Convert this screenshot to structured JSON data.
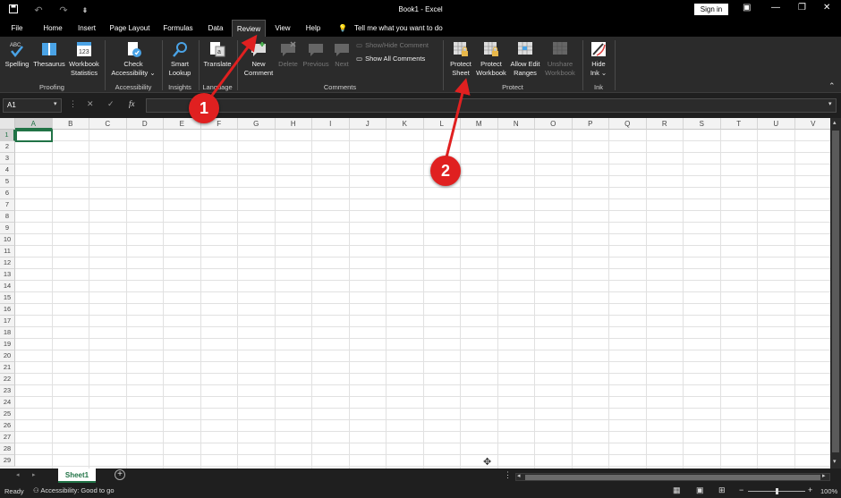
{
  "titlebar": {
    "doc_title": "Book1 - Excel",
    "signin_label": "Sign in",
    "icons": [
      "save-icon",
      "undo-icon",
      "redo-icon",
      "customize-icon"
    ]
  },
  "menu": {
    "tabs": [
      "File",
      "Home",
      "Insert",
      "Page Layout",
      "Formulas",
      "Data",
      "Review",
      "View",
      "Help"
    ],
    "active_tab": "Review",
    "tell_me": "Tell me what you want to do"
  },
  "ribbon": {
    "proofing": {
      "spelling": "Spelling",
      "spelling_abc": "ABC",
      "thesaurus": "Thesaurus",
      "workbook_stats_1": "Workbook",
      "workbook_stats_2": "Statistics",
      "label": "Proofing"
    },
    "accessibility": {
      "check_1": "Check",
      "check_2": "Accessibility ⌄",
      "label": "Accessibility"
    },
    "insights": {
      "smart_1": "Smart",
      "smart_2": "Lookup",
      "label": "Insights"
    },
    "language": {
      "translate": "Translate",
      "label": "Language"
    },
    "comments": {
      "new_1": "New",
      "new_2": "Comment",
      "delete": "Delete",
      "previous": "Previous",
      "next": "Next",
      "show_hide": "Show/Hide Comment",
      "show_all": "Show All Comments",
      "label": "Comments"
    },
    "protect": {
      "protect_sheet_1": "Protect",
      "protect_sheet_2": "Sheet",
      "protect_wb_1": "Protect",
      "protect_wb_2": "Workbook",
      "allow_edit_1": "Allow Edit",
      "allow_edit_2": "Ranges",
      "unshare_1": "Unshare",
      "unshare_2": "Workbook",
      "label": "Protect"
    },
    "ink": {
      "hide_1": "Hide",
      "hide_2": "Ink ⌄",
      "label": "Ink"
    }
  },
  "formula_bar": {
    "name_box": "A1",
    "cancel": "✕",
    "enter": "✓",
    "fx": "fx",
    "value": ""
  },
  "grid": {
    "columns": [
      "A",
      "B",
      "C",
      "D",
      "E",
      "F",
      "G",
      "H",
      "I",
      "J",
      "K",
      "L",
      "M",
      "N",
      "O",
      "P",
      "Q",
      "R",
      "S",
      "T",
      "U",
      "V"
    ],
    "rows": [
      "1",
      "2",
      "3",
      "4",
      "5",
      "6",
      "7",
      "8",
      "9",
      "10",
      "11",
      "12",
      "13",
      "14",
      "15",
      "16",
      "17",
      "18",
      "19",
      "20",
      "21",
      "22",
      "23",
      "24",
      "25",
      "26",
      "27",
      "28",
      "29"
    ],
    "active_cell": "A1"
  },
  "sheets": {
    "tabs": [
      "Sheet1"
    ],
    "add_label": "+"
  },
  "status": {
    "ready": "Ready",
    "accessibility": "Accessibility: Good to go",
    "zoom": "100%",
    "zoom_minus": "−",
    "zoom_plus": "+"
  },
  "annotations": [
    "1",
    "2"
  ],
  "colors": {
    "accent": "#217346",
    "marker": "#e02020"
  }
}
